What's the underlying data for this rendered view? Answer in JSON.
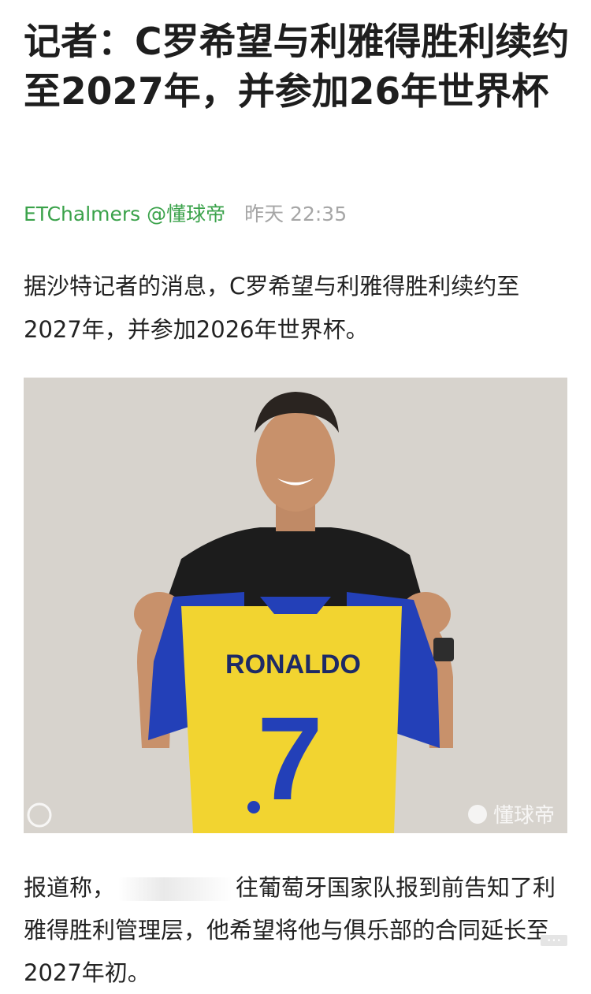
{
  "article": {
    "title": "记者：C罗希望与利雅得胜利续约至2027年，并参加26年世界杯",
    "author": "ETChalmers @懂球帝",
    "time": "昨天 22:35",
    "intro": "据沙特记者的消息，C罗希望与利雅得胜利续约至2027年，并参加2026年世界杯。",
    "body_prefix": "报道称，",
    "body_rest": "往葡萄牙国家队报到前告知了利雅得胜利管理层，他希望将他与俱乐部的合同延长至2027年初。",
    "more_badge": "···"
  },
  "photo": {
    "shirt_name": "RONALDO",
    "shirt_number": "7",
    "watermark": "懂球帝",
    "colors": {
      "background": "#dcd8d3",
      "jersey_yellow": "#f2d430",
      "jersey_blue": "#2340b8",
      "shirt_black": "#1c1c1c",
      "skin": "#c8916b"
    }
  }
}
